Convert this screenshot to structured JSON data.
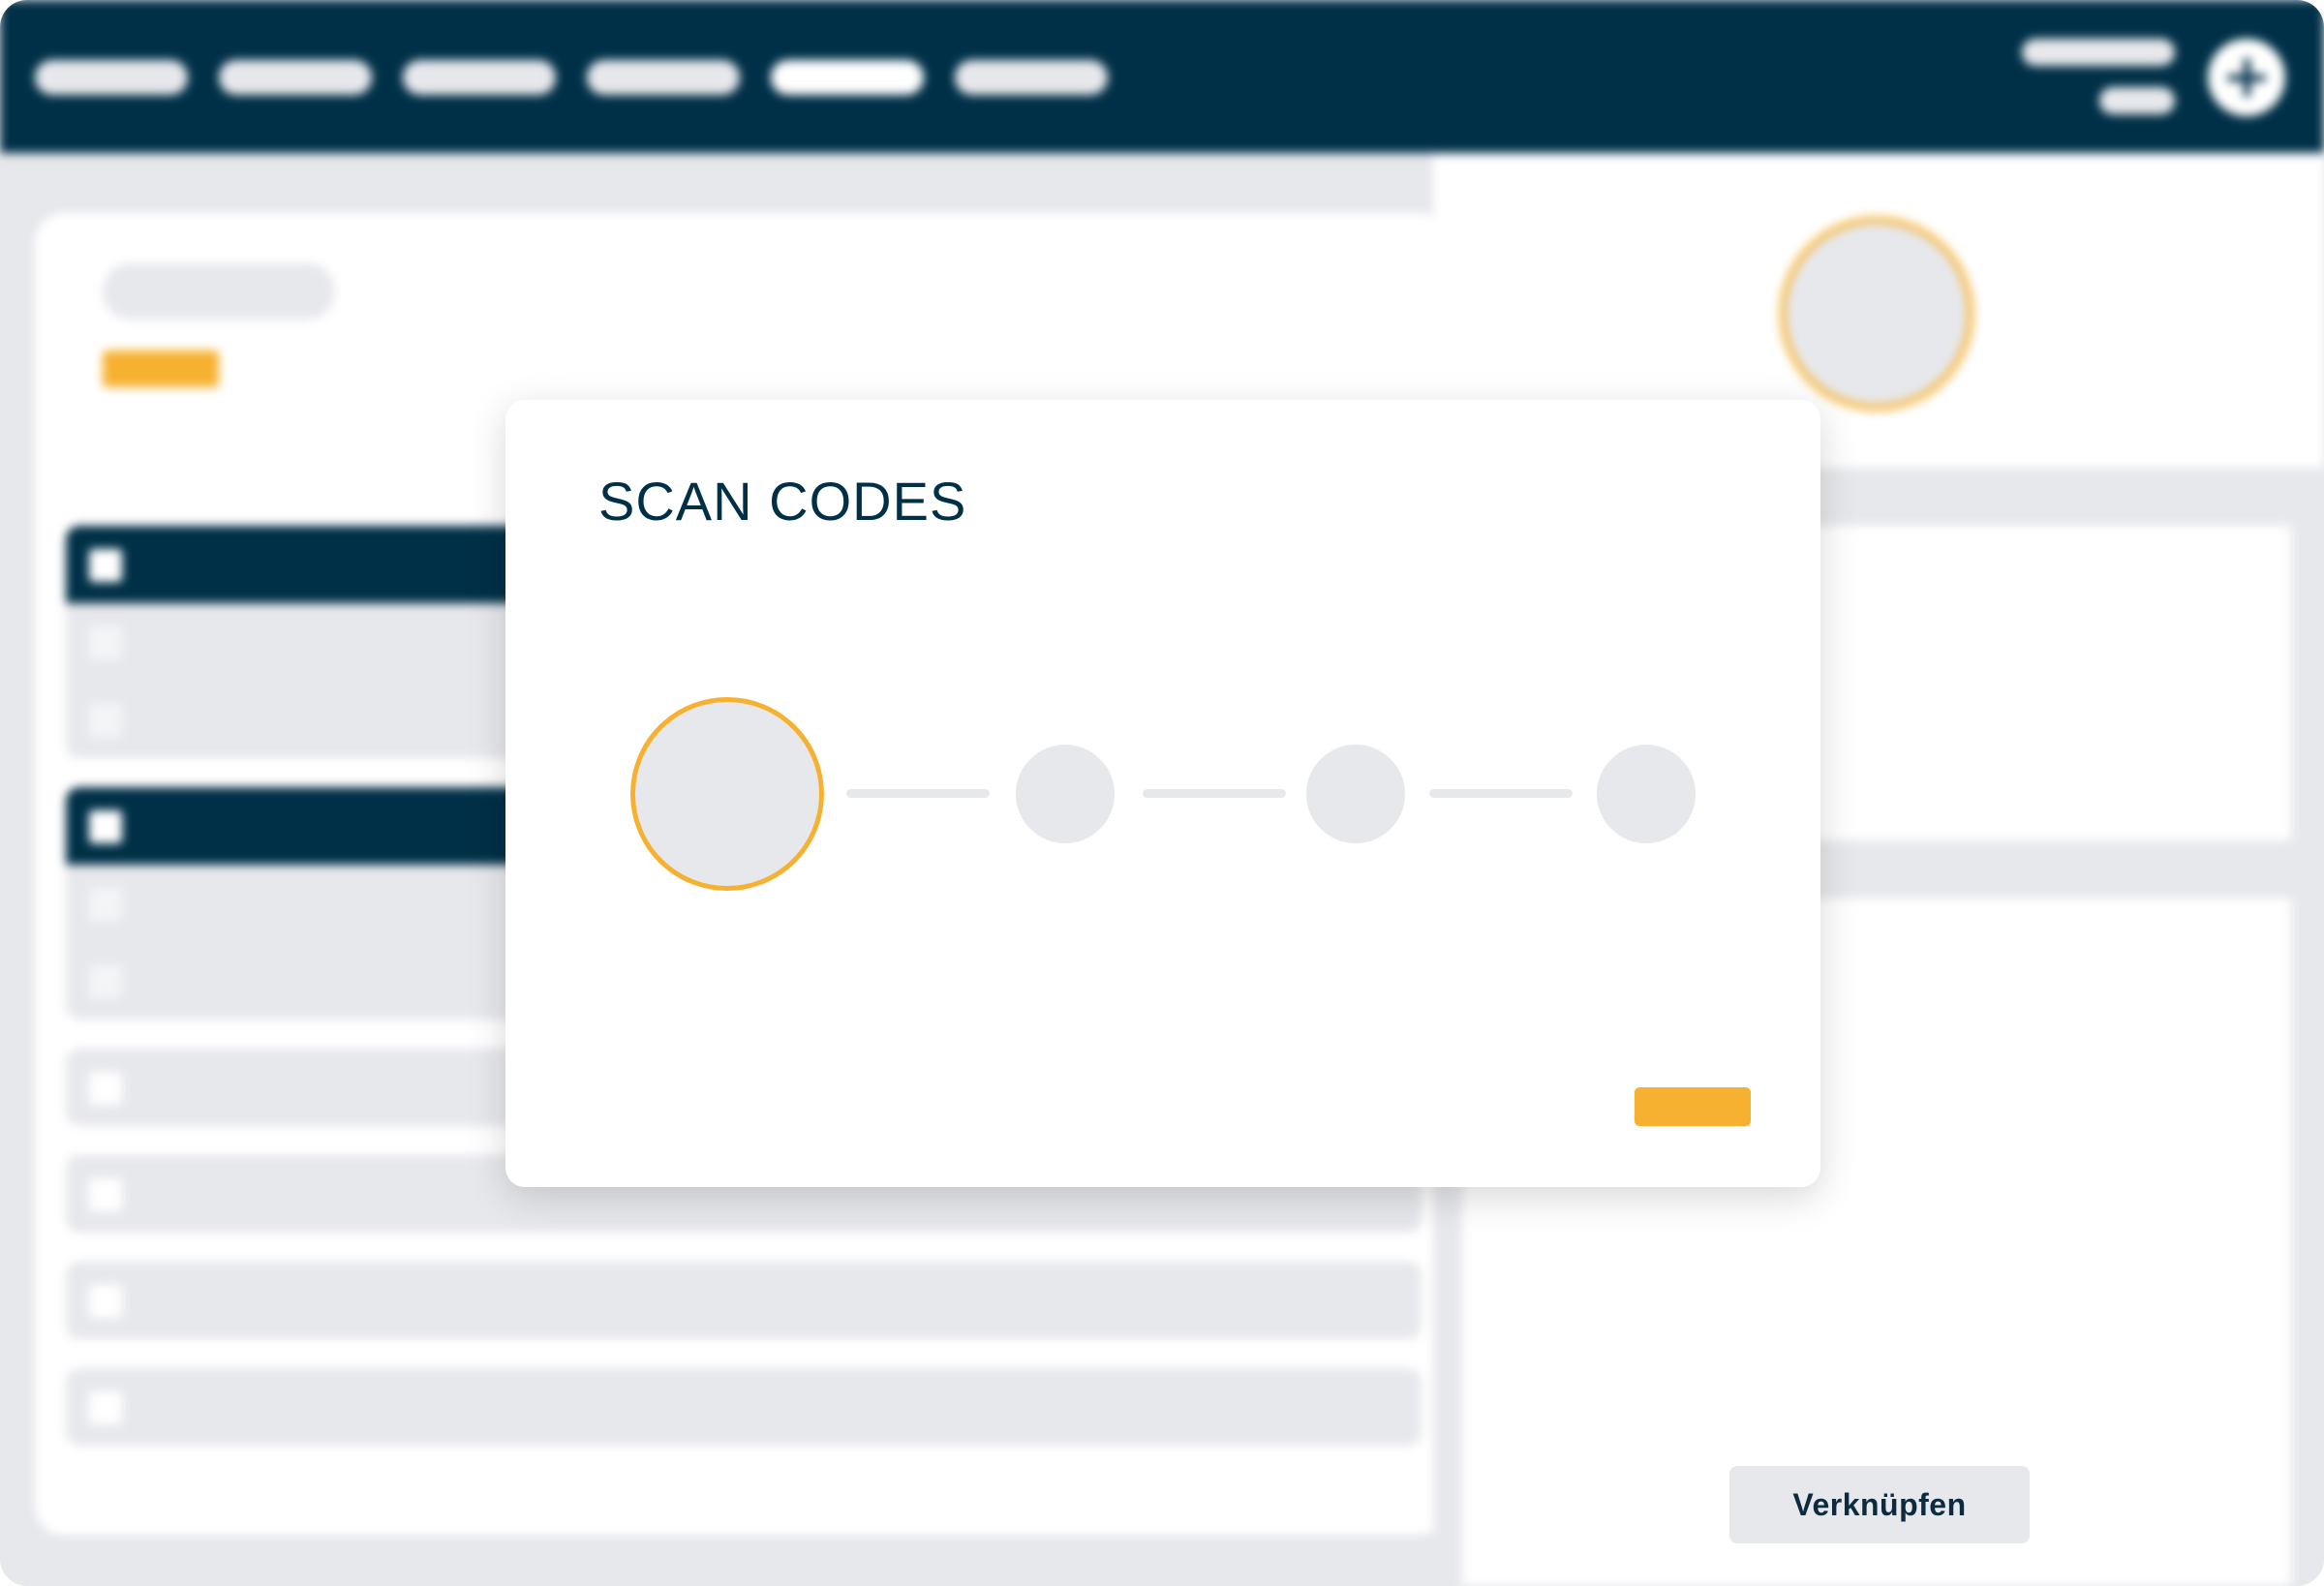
{
  "dialog": {
    "title": "SCAN CODES",
    "steps": [
      {
        "state": "current"
      },
      {
        "state": "pending"
      },
      {
        "state": "pending"
      },
      {
        "state": "pending"
      }
    ]
  },
  "sidebar_panel": {
    "link_button_label": "Verknüpfen"
  },
  "colors": {
    "navy": "#003047",
    "accent": "#f7b131",
    "placeholder": "#e7e8ec",
    "surface": "#ffffff"
  }
}
